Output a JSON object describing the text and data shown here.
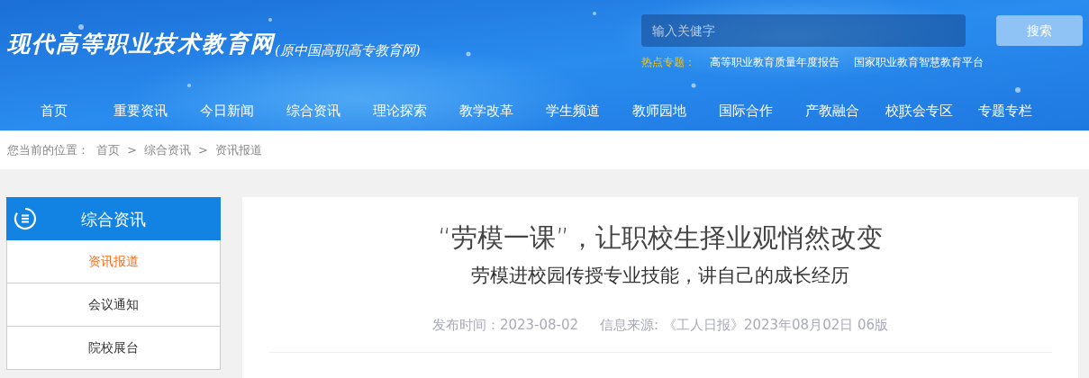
{
  "site": {
    "title": "现代高等职业技术教育网",
    "subtitle": "(原中国高职高专教育网)"
  },
  "search": {
    "placeholder": "输入关健字",
    "button": "搜索"
  },
  "hot_topics": {
    "label": "热点专题：",
    "links": [
      "高等职业教育质量年度报告",
      "国家职业教育智慧教育平台"
    ]
  },
  "nav": [
    "首页",
    "重要资讯",
    "今日新闻",
    "综合资讯",
    "理论探索",
    "教学改革",
    "学生频道",
    "教师园地",
    "国际合作",
    "产教融合",
    "校联会专区",
    "专题专栏"
  ],
  "breadcrumb": {
    "label": "您当前的位置：",
    "separator": ">",
    "items": [
      "首页",
      "综合资讯",
      "资讯报道"
    ]
  },
  "sidebar": {
    "title": "综合资讯",
    "items": [
      {
        "label": "资讯报道",
        "selected": true
      },
      {
        "label": "会议通知",
        "selected": false
      },
      {
        "label": "院校展台",
        "selected": false
      }
    ]
  },
  "article": {
    "title": "“劳模一课”，让职校生择业观悄然改变",
    "subtitle": "劳模进校园传授专业技能，讲自己的成长经历",
    "published_label": "发布时间：",
    "published": "2023-08-02",
    "source_label": "信息来源:",
    "source": "《工人日报》2023年08月02日 06版"
  }
}
